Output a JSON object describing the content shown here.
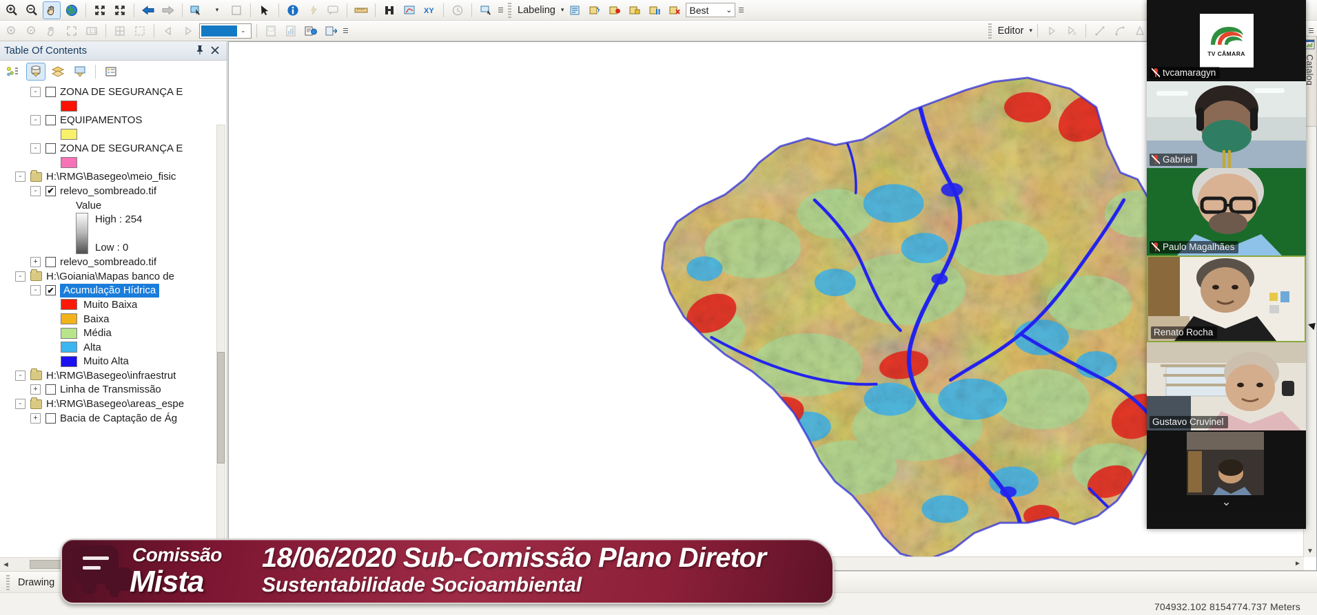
{
  "app": {
    "toc_panel_title": "Table Of Contents",
    "catalog_tab_label": "Catalog"
  },
  "toolbar_top": {
    "labeling_label": "Labeling",
    "labeling_caret": "▾",
    "best_option": "Best",
    "combo_caret": "⌄",
    "icons": [
      "zoom-in-icon",
      "zoom-out-icon",
      "pan-icon",
      "globe-full-extent-icon",
      "fixed-zoom-in-icon",
      "fixed-zoom-out-icon",
      "go-back-extent-icon",
      "go-next-extent-icon",
      "select-features-icon",
      "clear-selection-icon",
      "select-elements-icon",
      "identify-icon",
      "hyperlink-icon",
      "html-popup-icon",
      "measure-icon",
      "find-icon",
      "find-route-icon",
      "go-to-xy-icon",
      "time-slider-icon",
      "create-viewer-window-icon",
      "label-manager-icon",
      "label-priority-icon",
      "label-weight-icon",
      "lock-labels-icon",
      "pause-labeling-icon",
      "delete-labels-icon"
    ]
  },
  "toolbar_second": {
    "editor_label": "Editor",
    "editor_caret": "▾",
    "icons": [
      "zoom-in-data-icon",
      "zoom-out-data-icon",
      "pan-data-icon",
      "full-extent-data-icon",
      "scale-1to1-icon",
      "grid-icon",
      "extent-icon",
      "previous-extent-icon",
      "next-extent-icon",
      "color-swatch",
      "page-layout-icon",
      "chart-icon",
      "report-icon",
      "export-icon",
      "edit-vertices-icon",
      "sketch-tool-icon",
      "straight-segment-icon",
      "arc-segment-icon",
      "shape-construction-icon",
      "snapping-icon",
      "trace-icon",
      "split-icon",
      "construct-points-icon",
      "delete-sketch-icon",
      "sketch-properties-icon",
      "attributes-icon"
    ],
    "color_swatch_hex": "#1479c4"
  },
  "toc": {
    "title": "Table Of Contents",
    "pin_icon": "pin-icon",
    "close_icon": "close-icon",
    "tool_icons": [
      "list-by-drawing-order-icon",
      "list-by-source-icon",
      "list-by-visibility-icon",
      "list-by-selection-icon",
      "options-icon"
    ],
    "tree": [
      {
        "kind": "layer",
        "indent": 2,
        "expander": "-",
        "checked": false,
        "label": "ZONA DE SEGURANÇA E"
      },
      {
        "kind": "symbol",
        "indent": 4,
        "color": "#ff1100",
        "label": ""
      },
      {
        "kind": "layer",
        "indent": 2,
        "expander": "-",
        "checked": false,
        "label": "EQUIPAMENTOS"
      },
      {
        "kind": "symbol",
        "indent": 4,
        "color": "#f8ef6a",
        "label": ""
      },
      {
        "kind": "layer",
        "indent": 2,
        "expander": "-",
        "checked": false,
        "label": "ZONA DE SEGURANÇA E"
      },
      {
        "kind": "symbol",
        "indent": 4,
        "color": "#f772b6",
        "label": ""
      },
      {
        "kind": "folder",
        "indent": 1,
        "expander": "-",
        "label": "H:\\RMG\\Basegeo\\meio_fisic"
      },
      {
        "kind": "layer",
        "indent": 2,
        "expander": "-",
        "checked": true,
        "label": "relevo_sombreado.tif"
      },
      {
        "kind": "text",
        "indent": 5,
        "label": "Value"
      },
      {
        "kind": "ramp",
        "indent": 5,
        "high": "High : 254",
        "low": "Low : 0"
      },
      {
        "kind": "layer",
        "indent": 2,
        "expander": "+",
        "checked": false,
        "label": "relevo_sombreado.tif"
      },
      {
        "kind": "folder",
        "indent": 1,
        "expander": "-",
        "label": "H:\\Goiania\\Mapas banco de"
      },
      {
        "kind": "layer",
        "indent": 2,
        "expander": "-",
        "checked": true,
        "label": "Acumulação Hídrica",
        "selected": true
      },
      {
        "kind": "legend",
        "indent": 4,
        "color": "#fb1a07",
        "label": "Muito Baixa"
      },
      {
        "kind": "legend",
        "indent": 4,
        "color": "#f2b21a",
        "label": "Baixa"
      },
      {
        "kind": "legend",
        "indent": 4,
        "color": "#b8e48c",
        "label": "Média"
      },
      {
        "kind": "legend",
        "indent": 4,
        "color": "#3ab6f0",
        "label": "Alta"
      },
      {
        "kind": "legend",
        "indent": 4,
        "color": "#1b10f0",
        "label": "Muito Alta"
      },
      {
        "kind": "folder",
        "indent": 1,
        "expander": "-",
        "label": "H:\\RMG\\Basegeo\\infraestrut"
      },
      {
        "kind": "layer",
        "indent": 2,
        "expander": "+",
        "checked": false,
        "label": "Linha de Transmissão"
      },
      {
        "kind": "folder",
        "indent": 1,
        "expander": "-",
        "label": "H:\\RMG\\Basegeo\\areas_espe"
      },
      {
        "kind": "layer",
        "indent": 2,
        "expander": "+",
        "checked": false,
        "label": "Bacia de Captação de Ág"
      }
    ]
  },
  "map": {
    "layer_name": "Acumulação Hídrica",
    "legend_colors": [
      "#fb1a07",
      "#f2b21a",
      "#b8e48c",
      "#3ab6f0",
      "#1b10f0"
    ]
  },
  "drawing_bar": {
    "label": "Drawing",
    "caret": "▾",
    "icons": [
      "select-elements-arrow-icon",
      "drawing-grip"
    ]
  },
  "status": {
    "coordinates": "704932.102  8154774.737 Meters"
  },
  "video": {
    "logo_title": "TV CÂMARA",
    "chevron_icon": "chevron-down-icon",
    "participants": [
      {
        "name": "tvcamaragyn",
        "mic": "mic-muted-icon"
      },
      {
        "name": "Gabriel",
        "mic": "mic-muted-icon"
      },
      {
        "name": "Paulo Magalhães",
        "mic": "mic-muted-icon"
      },
      {
        "name": "Renato Rocha",
        "mic": ""
      },
      {
        "name": "Gustavo Cruvinel",
        "mic": ""
      },
      {
        "name": "",
        "mic": ""
      }
    ]
  },
  "banner": {
    "logo_word1": "Comissão",
    "logo_word2": "Mista",
    "line1": "18/06/2020 Sub-Comissão Plano Diretor",
    "line2": "Sustentabilidade Socioambiental"
  }
}
